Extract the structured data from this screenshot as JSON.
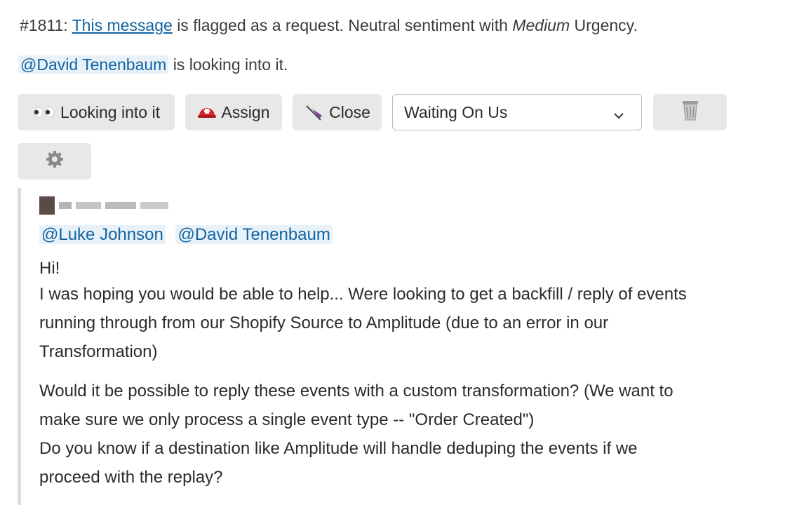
{
  "header": {
    "ticket_id": "#1811:",
    "message_link": "This message",
    "text_before_urgency": "is flagged as a request. Neutral sentiment with",
    "urgency": "Medium",
    "urgency_suffix": "Urgency."
  },
  "status_line": {
    "mention": "@David Tenenbaum",
    "text": "is looking into it."
  },
  "actions": {
    "looking_label": "Looking into it",
    "assign_label": "Assign",
    "close_label": "Close",
    "status_select_value": "Waiting On Us"
  },
  "icons": {
    "eyes": "eyes-icon",
    "assign": "rescue-helmet-icon",
    "close": "umbrella-icon",
    "delete": "trash-icon",
    "settings": "gear-icon",
    "select": "chevron-down-icon"
  },
  "colors": {
    "link": "#1264a3",
    "mention_bg": "#e8f1f8",
    "button_bg": "#e8e8e8",
    "quote_bar": "#dddddd"
  },
  "message": {
    "mentions": [
      "@Luke Johnson",
      "@David Tenenbaum"
    ],
    "lines": [
      "Hi!",
      "I was hoping you would be able to help... Were looking to get a backfill / reply of events",
      "running through from our Shopify Source to Amplitude (due to an error in our",
      "Transformation)",
      "Would it be possible to reply these events with a custom transformation? (We want to",
      "make sure we only process a single event type -- \"Order Created\")",
      "Do you know if a destination like Amplitude will handle deduping the events if we",
      "proceed with the replay?"
    ]
  }
}
